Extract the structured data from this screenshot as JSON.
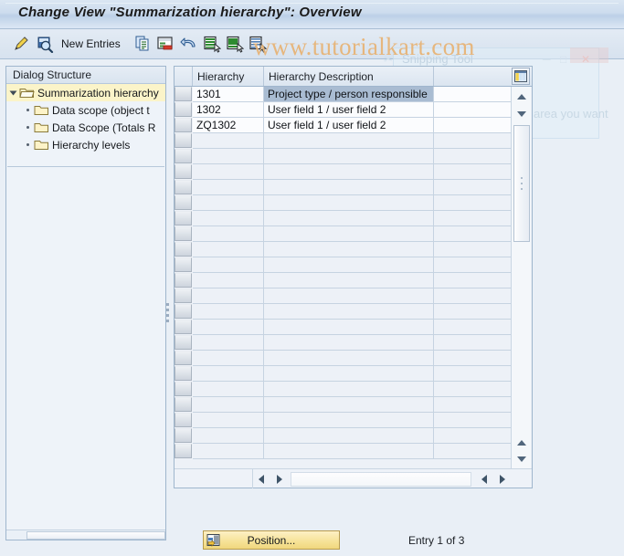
{
  "window": {
    "title": "Change View \"Summarization hierarchy\": Overview"
  },
  "toolbar": {
    "items": [
      {
        "name": "change-edit-icon",
        "label": "",
        "icon": "pencil-icon"
      },
      {
        "name": "display-magnifier-icon",
        "label": "",
        "icon": "magnifier-icon"
      },
      {
        "name": "new-entries-button",
        "label": "New Entries",
        "icon": ""
      },
      {
        "name": "copy-as-icon",
        "label": "",
        "icon": "copy-icon"
      },
      {
        "name": "delete-icon",
        "label": "",
        "icon": "delete-row-icon"
      },
      {
        "name": "undo-icon",
        "label": "",
        "icon": "undo-arrow-icon"
      },
      {
        "name": "select-all-icon",
        "label": "",
        "icon": "select-all-icon"
      },
      {
        "name": "select-block-icon",
        "label": "",
        "icon": "select-block-icon"
      },
      {
        "name": "deselect-all-icon",
        "label": "",
        "icon": "deselect-all-icon"
      }
    ]
  },
  "watermark": {
    "text": "www.tutorialkart.com"
  },
  "ghost_window": {
    "title": "Snipping Tool",
    "message": "Drag the cursor around the area you want to capture.",
    "minimize": "─",
    "maximize": "□",
    "close": "✕"
  },
  "sidebar": {
    "header": "Dialog Structure",
    "items": [
      {
        "label": "Summarization hierarchy",
        "level": 0,
        "selected": true
      },
      {
        "label": "Data scope (object t",
        "level": 1,
        "selected": false
      },
      {
        "label": "Data Scope (Totals R",
        "level": 1,
        "selected": false
      },
      {
        "label": "Hierarchy levels",
        "level": 1,
        "selected": false
      }
    ]
  },
  "table": {
    "columns": [
      "Hierarchy",
      "Hierarchy Description",
      ""
    ],
    "rows": [
      {
        "hierarchy": "1301",
        "description": "Project type / person responsible",
        "extra": "",
        "selected": true
      },
      {
        "hierarchy": "1302",
        "description": "User field 1 / user field 2",
        "extra": "",
        "selected": false
      },
      {
        "hierarchy": "ZQ1302",
        "description": "User field 1 / user field 2",
        "extra": "",
        "selected": false
      }
    ],
    "empty_rows": 21,
    "config_icon": "column-config-icon"
  },
  "footer": {
    "position_button": "Position...",
    "position_icon": "position-icon",
    "entry_status": "Entry 1 of 3"
  },
  "colors": {
    "title_bar": "#cddcee",
    "toolbar": "#dde7f1",
    "panel_border": "#9fb6cd",
    "tree_selected": "#fbf4c9",
    "row_highlight": "#a9bcd2",
    "button_yellow": "#f6e296",
    "watermark": "#e7b477"
  }
}
